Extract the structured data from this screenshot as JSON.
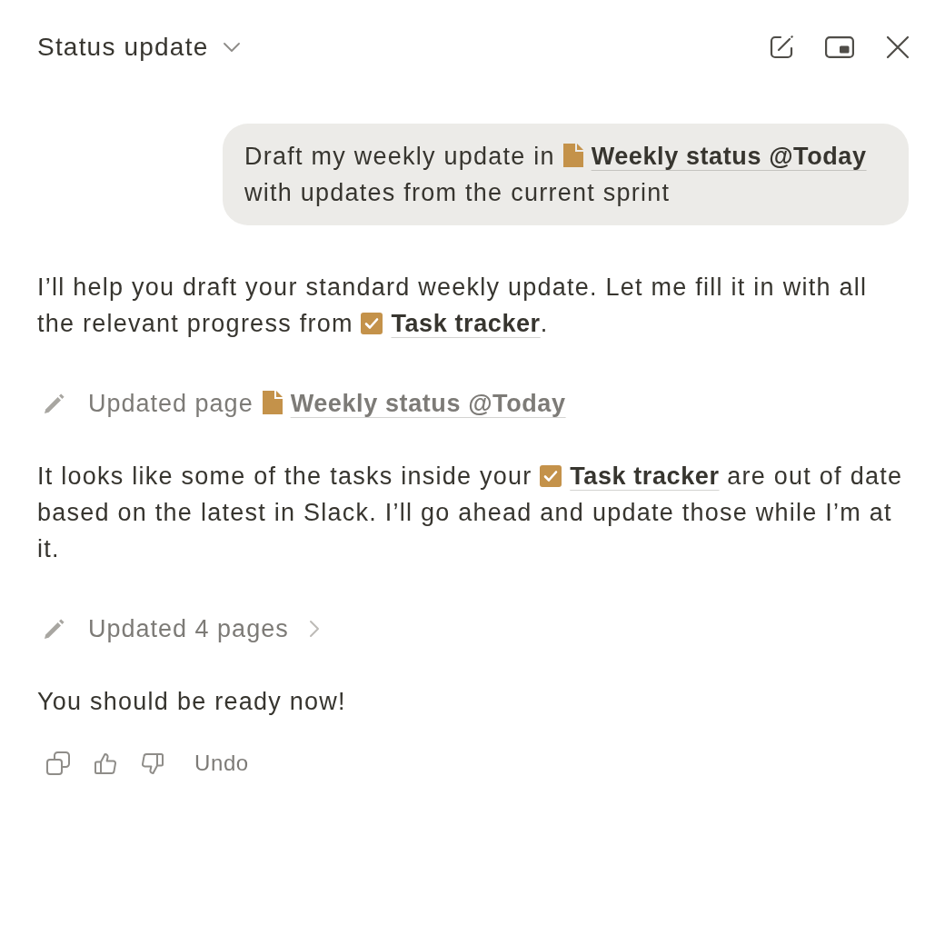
{
  "header": {
    "title": "Status update"
  },
  "messages": [
    {
      "kind": "user",
      "parts": [
        {
          "kind": "text",
          "text": "Draft my weekly update in "
        },
        {
          "kind": "page",
          "text": "Weekly status @Today"
        },
        {
          "kind": "text",
          "text": " with updates from the current sprint"
        }
      ]
    },
    {
      "kind": "assistant",
      "parts": [
        {
          "kind": "text",
          "text": "I’ll help you draft your standard weekly update. Let me fill it in with all the relevant progress from "
        },
        {
          "kind": "task",
          "text": "Task tracker"
        },
        {
          "kind": "text",
          "text": "."
        }
      ]
    },
    {
      "kind": "action",
      "text": "Updated page",
      "mention": {
        "kind": "page",
        "text": "Weekly status @Today"
      }
    },
    {
      "kind": "assistant",
      "parts": [
        {
          "kind": "text",
          "text": "It looks like some of the tasks inside your "
        },
        {
          "kind": "task",
          "text": "Task tracker"
        },
        {
          "kind": "text",
          "text": " are out of date based on the latest in Slack. I’ll go ahead and update those while I’m at it."
        }
      ]
    },
    {
      "kind": "action_group",
      "text": "Updated 4 pages",
      "expanded": false
    },
    {
      "kind": "assistant",
      "parts": [
        {
          "kind": "text",
          "text": "You should be ready now!"
        }
      ]
    }
  ],
  "feedback": {
    "undo": "Undo"
  }
}
